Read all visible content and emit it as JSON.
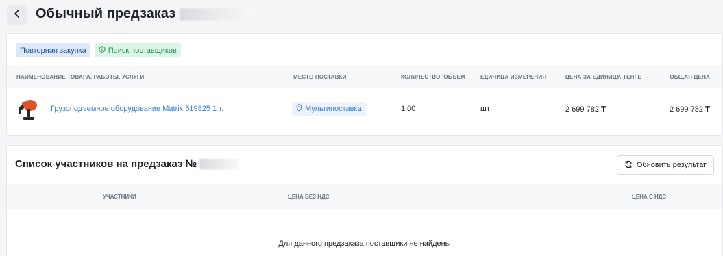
{
  "header": {
    "title": "Обычный предзаказ"
  },
  "order": {
    "badges": {
      "repeat_purchase": "Повторная закупка",
      "supplier_search": "Поиск поставщиков"
    },
    "columns": [
      "НАИМЕНОВАНИЕ ТОВАРА, РАБОТЫ, УСЛУГИ",
      "МЕСТО ПОСТАВКИ",
      "КОЛИЧЕСТВО, ОБЪЕМ",
      "ЕДИНИЦА ИЗМЕРЕНИЯ",
      "ЦЕНА ЗА ЕДИНИЦУ, ТЕНГЕ",
      "ОБЩАЯ ЦЕНА"
    ],
    "row": {
      "product": "Грузоподъемное оборудование Matrix 519825 1 т.",
      "location": "Мультипоставка",
      "quantity": "1.00",
      "unit": "шт",
      "unit_price": "2 699 782 ₸",
      "total_price": "2 699 782 ₸"
    }
  },
  "participants": {
    "title": "Список участников на предзаказ №",
    "refresh_label": "Обновить результат",
    "columns": [
      "УЧАСТНИКИ",
      "ЦЕНА БЕЗ НДС",
      "ЦЕНА С НДС"
    ],
    "empty_message": "Для данного предзаказа поставщики не найдены"
  },
  "colors": {
    "accent": "#2f7fd8",
    "success": "#1a9550",
    "badge_blue": "#dbe9fb",
    "badge_green": "#ddf5e6"
  },
  "icons": {
    "back": "chevron-left-icon",
    "info": "info-circle-icon",
    "location": "location-pin-icon",
    "refresh": "refresh-icon"
  }
}
